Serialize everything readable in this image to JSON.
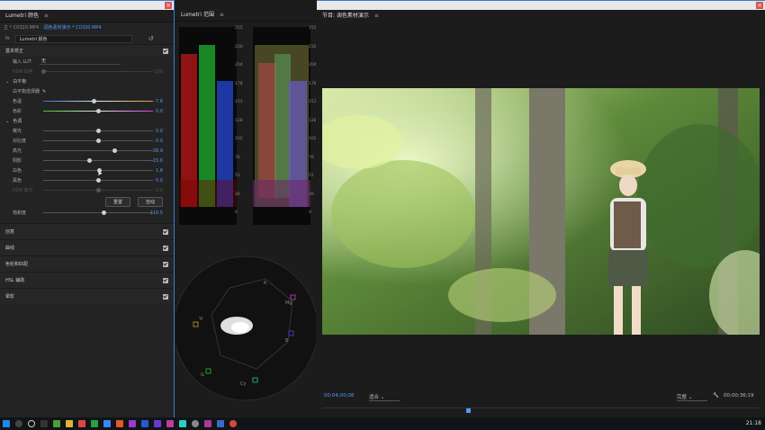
{
  "lumetri_panel": {
    "title": "Lumetri 颜色",
    "clip_source": "主 * C0320.MP4",
    "clip_sequence": "调色素材演示 * C0320.MP4",
    "fx_label": "fx",
    "effect_name": "Lumetri 颜色",
    "basic_correction": {
      "label": "基本校正",
      "input_lut_label": "输入 LUT",
      "input_lut_value": "无",
      "hdr_label": "HDR 白色",
      "hdr_value": "100",
      "white_balance_label": "白平衡",
      "wb_selector_label": "白平衡选择器",
      "temperature": {
        "label": "色温",
        "value": "-7.6",
        "level": 0.46
      },
      "tint": {
        "label": "色彩",
        "value": "0.0",
        "level": 0.5
      },
      "tone_label": "色调",
      "exposure": {
        "label": "曝光",
        "value": "0.0",
        "level": 0.5
      },
      "contrast": {
        "label": "对比度",
        "value": "0.0",
        "level": 0.5
      },
      "highlights": {
        "label": "高光",
        "value": "38.9",
        "level": 0.65
      },
      "shadows": {
        "label": "阴影",
        "value": "-15.6",
        "level": 0.42
      },
      "whites": {
        "label": "白色",
        "value": "1.6",
        "level": 0.51
      },
      "blacks": {
        "label": "黑色",
        "value": "0.0",
        "level": 0.5
      },
      "hdr_specular": {
        "label": "HDR 高光",
        "value": "0.0",
        "level": 0.5
      },
      "reset_label": "重置",
      "auto_label": "自动",
      "saturation": {
        "label": "饱和度",
        "value": "110.5",
        "level": 0.55
      }
    },
    "sections": [
      "创意",
      "曲线",
      "色轮和匹配",
      "HSL 辅助",
      "晕影"
    ]
  },
  "scopes_panel": {
    "title": "Lumetri 范围",
    "scale_left": [
      "255",
      "230",
      "204",
      "178",
      "153",
      "128",
      "102",
      "76",
      "51",
      "26",
      "0"
    ],
    "scale_right": [
      "255",
      "230",
      "204",
      "178",
      "153",
      "128",
      "102",
      "76",
      "51",
      "26",
      "0"
    ],
    "vectorscope_labels": [
      "R",
      "Mg",
      "B",
      "Cy",
      "G",
      "Yl"
    ]
  },
  "program_monitor": {
    "title": "节目: 调色素材演示",
    "timecode": "00;04;00;08",
    "fit": "适合",
    "quality": "完整",
    "duration": "00;00;36;19",
    "playhead_position": 0.33
  },
  "taskbar": {
    "time": "21:18"
  },
  "colors": {
    "accent": "#4d9bff",
    "panel_border": "#3a7bd5",
    "close": "#d9534f"
  }
}
